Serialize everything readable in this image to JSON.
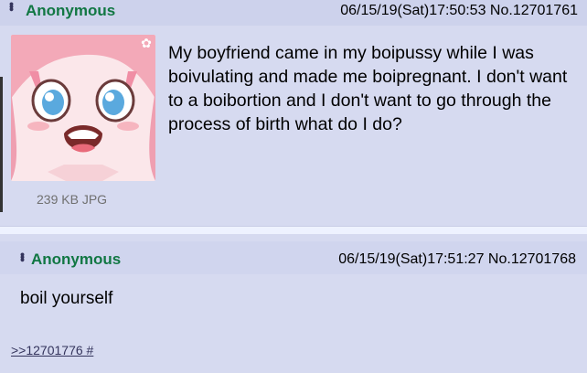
{
  "post1": {
    "name": "Anonymous",
    "dateline": "06/15/19(Sat)17:50:53 No.12701761",
    "filesize": "239 KB JPG",
    "body": "My boyfriend came in my boipussy while I was boivulating and made me boipregnant. I don't want to a boibortion and I don't want to go through the process of birth what do I do?",
    "thumbnail_icon": "anime-girl-thumbnail"
  },
  "post2": {
    "name": "Anonymous",
    "dateline": "06/15/19(Sat)17:51:27 No.12701768",
    "body": "boil yourself",
    "reply_link": ">>12701776 #"
  },
  "colors": {
    "background": "#eef2ff",
    "post": "#d6daf0",
    "name": "#117743",
    "link": "#34345c"
  }
}
